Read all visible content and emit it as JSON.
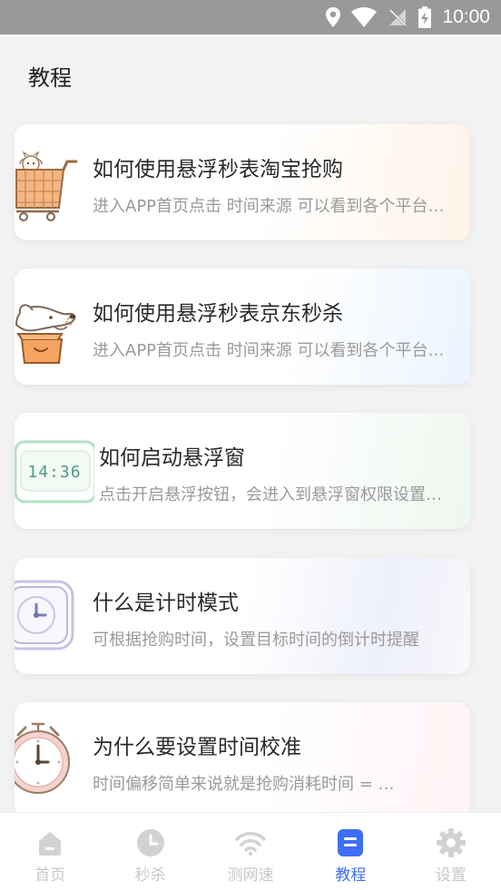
{
  "status_bar": {
    "time": "10:00"
  },
  "page": {
    "title": "教程"
  },
  "tutorials": [
    {
      "title": "如何使用悬浮秒表淘宝抢购",
      "desc": "进入APP首页点击 时间来源 可以看到各个平台的时间"
    },
    {
      "title": "如何使用悬浮秒表京东秒杀",
      "desc": "进入APP首页点击 时间来源 可以看到各个平台的时间"
    },
    {
      "title": "如何启动悬浮窗",
      "desc": "点击开启悬浮按钮，会进入到悬浮窗权限设置页面"
    },
    {
      "title": "什么是计时模式",
      "desc": "可根据抢购时间，设置目标时间的倒计时提醒"
    },
    {
      "title": "为什么要设置时间校准",
      "desc": "时间偏移简单来说就是抢购消耗时间 = …"
    }
  ],
  "clock_illustration": {
    "display": "14:36"
  },
  "tabbar": {
    "items": [
      {
        "label": "首页",
        "icon": "home-icon"
      },
      {
        "label": "秒杀",
        "icon": "clock-icon"
      },
      {
        "label": "测网速",
        "icon": "wifi-icon"
      },
      {
        "label": "教程",
        "icon": "tutorial-icon"
      },
      {
        "label": "设置",
        "icon": "gear-icon"
      }
    ],
    "active_index": 3
  },
  "colors": {
    "accent": "#3d6ef5",
    "status_bar": "#999999",
    "inactive": "#c8c8c8"
  }
}
